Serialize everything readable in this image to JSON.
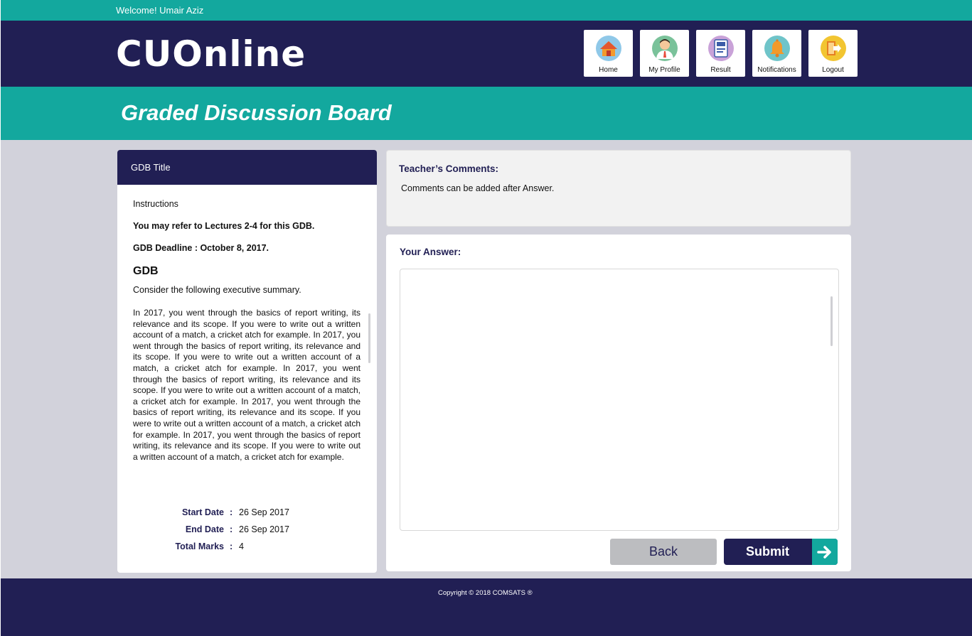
{
  "welcome": "Welcome! Umair Aziz",
  "brand": {
    "logo_text": "CUOnline"
  },
  "nav": [
    {
      "label": "Home",
      "icon": "home-icon",
      "color": "#8fc8e8"
    },
    {
      "label": "My Profile",
      "icon": "profile-icon",
      "color": "#7ac29a"
    },
    {
      "label": "Result",
      "icon": "result-icon",
      "color": "#c9a2d8"
    },
    {
      "label": "Notifications",
      "icon": "bell-icon",
      "color": "#6fc4c9"
    },
    {
      "label": "Logout",
      "icon": "logout-icon",
      "color": "#f2c531"
    }
  ],
  "page_title": "Graded Discussion Board",
  "gdb": {
    "header": "GDB Title",
    "instructions_label": "Instructions",
    "refer_note": "You may refer to Lectures 2-4 for this GDB.",
    "deadline": "GDB Deadline : October 8, 2017.",
    "heading": "GDB",
    "consider": "Consider the following executive summary.",
    "summary": "In 2017,  you went through the basics of report writing, its relevance and its scope. If you were to write out a written account of a match, a cricket atch for example. In 2017,  you went through the basics of report writing, its relevance and its scope. If you were to write out a written account of a match, a cricket atch for example. In 2017,  you went through the basics of report writing, its relevance and its scope. If you were to write out a written account of a match, a cricket atch for example. In 2017,  you went through the basics of report writing, its relevance and its scope. If you were to write out a written account of a match, a cricket atch for example. In 2017,  you went through the basics of report writing, its relevance and its scope. If you were to write out a written account of a match, a cricket atch for example.",
    "start_date_label": "Start Date",
    "start_date": "26 Sep 2017",
    "end_date_label": "End Date",
    "end_date": "26 Sep 2017",
    "total_marks_label": "Total Marks",
    "total_marks": "4",
    "colon": ":"
  },
  "comments": {
    "title": "Teacher’s Comments:",
    "text": "Comments can be added after Answer."
  },
  "answer": {
    "title": "Your Answer:",
    "value": "",
    "back_label": "Back",
    "submit_label": "Submit"
  },
  "footer": {
    "copyright": "Copyright © 2018 COMSATS ®"
  },
  "colors": {
    "navy": "#211f54",
    "teal": "#13a89e",
    "panel_bg": "#d2d2db"
  }
}
